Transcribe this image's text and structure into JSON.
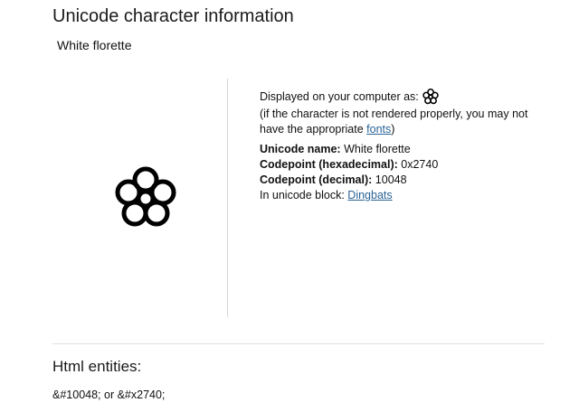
{
  "page": {
    "title": "Unicode character information",
    "character_name": "White florette"
  },
  "glyph": {
    "icon": "white-florette-glyph"
  },
  "info": {
    "displayed_label": "Displayed on your computer as:",
    "note_prefix": "(if the character is not rendered properly, you may not have the appropriate ",
    "note_link": "fonts",
    "note_suffix": ")",
    "unicode_name_label": "Unicode name:",
    "unicode_name_value": " White florette",
    "codepoint_hex_label": "Codepoint (hexadecimal):",
    "codepoint_hex_value": " 0x2740",
    "codepoint_dec_label": "Codepoint (decimal):",
    "codepoint_dec_value": " 10048",
    "block_label": "In unicode block: ",
    "block_link": "Dingbats"
  },
  "entities": {
    "title": "Html entities:",
    "text": "&#10048; or &#x2740;"
  },
  "colors": {
    "link": "#2a6496",
    "divider": "#d5d5d5"
  }
}
